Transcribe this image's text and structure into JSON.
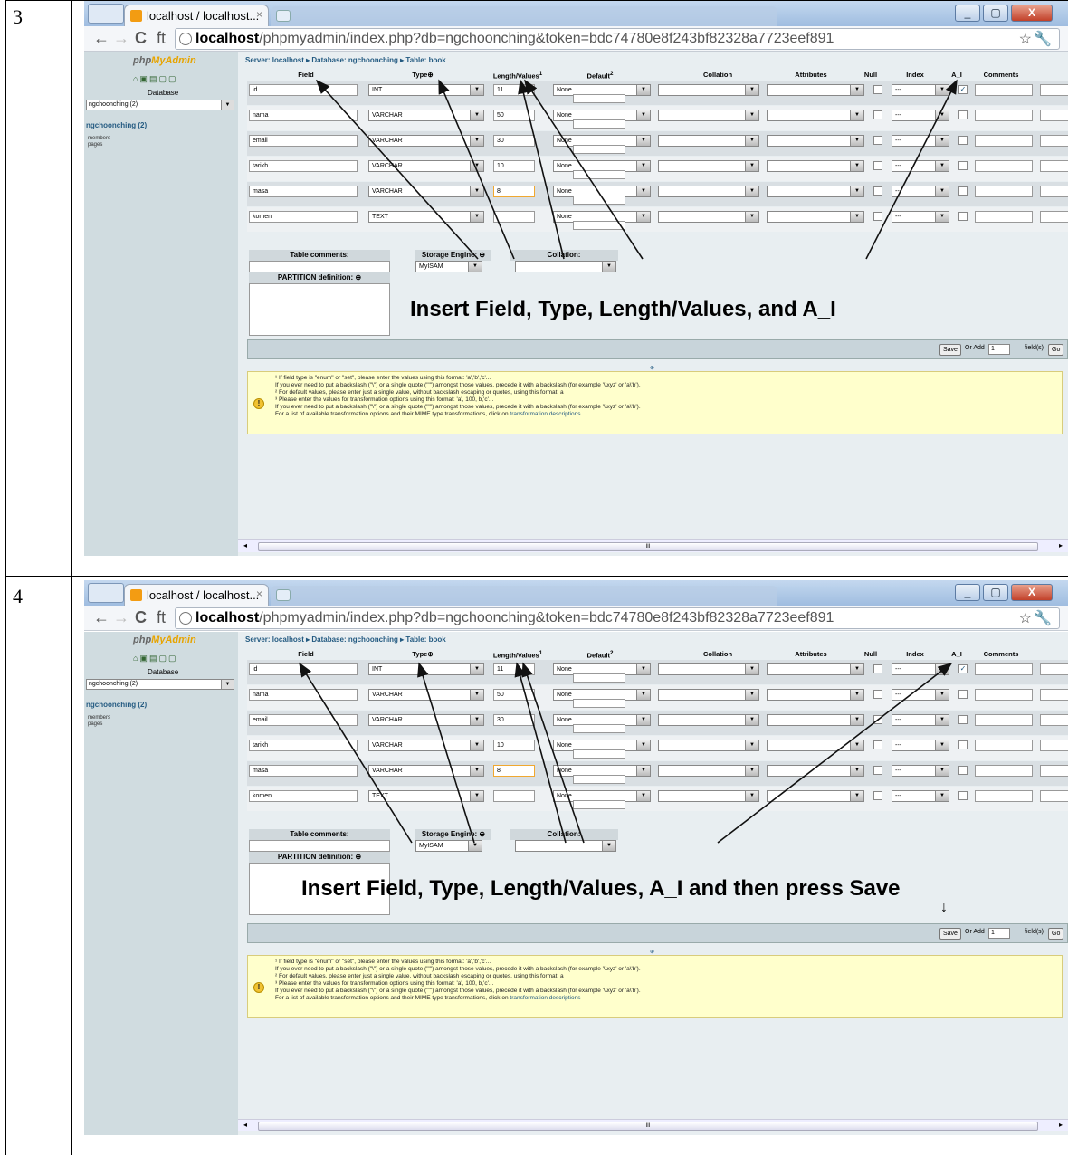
{
  "steps": [
    {
      "number": "3",
      "caption": "Insert Field, Type, Length/Values, and A_I",
      "save_hint_arrow": ""
    },
    {
      "number": "4",
      "caption": "Insert Field, Type, Length/Values, A_I and then press Save",
      "save_hint_arrow": "↓"
    }
  ],
  "browser": {
    "tab_title": "localhost / localhost...",
    "tab_close": "×",
    "url_host": "localhost",
    "url_path": "/phpmyadmin/index.php?db=ngchoonching&token=bdc74780e8f243bf82328a7723eef891",
    "back": "←",
    "forward": "→",
    "reload": "C",
    "home": "ft",
    "star": "☆",
    "wrench": "🔧",
    "min": "_",
    "max": "▢",
    "close": "X"
  },
  "sidebar": {
    "logo_php": "php",
    "logo_my": "MyAdmin",
    "icons": "⌂▣▤▢▢",
    "database_label": "Database",
    "database_select": "ngchoonching (2)",
    "db_link": "ngchoonching (2)",
    "tables": [
      "members",
      "pages"
    ]
  },
  "main": {
    "breadcrumb": "Server: localhost ▸ Database: ngchoonching ▸ Table: book",
    "headers": {
      "field": "Field",
      "type": "Type",
      "length": "Length/Values",
      "default": "Default",
      "collation": "Collation",
      "attributes": "Attributes",
      "null": "Null",
      "index": "Index",
      "ai": "A_I",
      "comments": "Comments"
    },
    "rows": [
      {
        "field": "id",
        "type": "INT",
        "length": "11",
        "default": "None",
        "index": "---",
        "ai": "✓"
      },
      {
        "field": "nama",
        "type": "VARCHAR",
        "length": "50",
        "default": "None",
        "index": "---",
        "ai": ""
      },
      {
        "field": "email",
        "type": "VARCHAR",
        "length": "30",
        "default": "None",
        "index": "---",
        "ai": ""
      },
      {
        "field": "tarikh",
        "type": "VARCHAR",
        "length": "10",
        "default": "None",
        "index": "---",
        "ai": ""
      },
      {
        "field": "masa",
        "type": "VARCHAR",
        "length": "8",
        "default": "None",
        "index": "---",
        "ai": ""
      },
      {
        "field": "komen",
        "type": "TEXT",
        "length": "",
        "default": "None",
        "index": "---",
        "ai": ""
      }
    ],
    "table_comments_label": "Table comments:",
    "storage_engine_label": "Storage Engine:",
    "storage_engine_value": "MyISAM",
    "collation_label": "Collation:",
    "partition_label": "PARTITION definition:",
    "save_label": "Save",
    "or_add_label": "Or Add",
    "add_count": "1",
    "fields_label": "field(s)",
    "go_label": "Go",
    "notice_lines": [
      "¹ If field type is \"enum\" or \"set\", please enter the values using this format: 'a','b','c'...",
      "If you ever need to put a backslash (\"\\\") or a single quote (\"'\") amongst those values, precede it with a backslash (for example '\\\\xyz' or 'a\\'b').",
      "² For default values, please enter just a single value, without backslash escaping or quotes, using this format: a",
      "³ Please enter the values for transformation options using this format: 'a', 100, b,'c'...",
      "If you ever need to put a backslash (\"\\\") or a single quote (\"'\") amongst those values, precede it with a backslash (for example '\\\\xyz' or 'a\\'b')."
    ],
    "notice_last": "For a list of available transformation options and their MIME type transformations, click on",
    "notice_link": "transformation descriptions",
    "scroll_thumb": "III"
  }
}
